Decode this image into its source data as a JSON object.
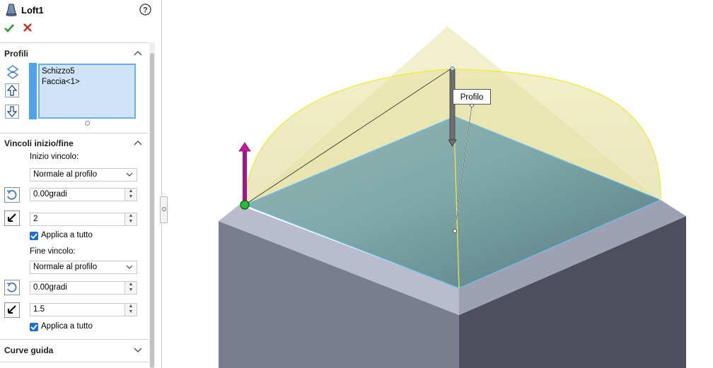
{
  "panel": {
    "title": "Loft1",
    "help_icon": "question-circle-icon",
    "ok_icon": "checkmark-icon",
    "cancel_icon": "x-icon",
    "profiles": {
      "title": "Profili",
      "items": [
        "Schizzo5",
        "Faccia<1>"
      ]
    },
    "constraints": {
      "title": "Vincoli inizio/fine",
      "start_label": "Inizio vincolo:",
      "start_type": "Normale al profilo",
      "start_angle": "0.00gradi",
      "start_length": "2",
      "start_apply_all": "Applica a tutto",
      "end_label": "Fine vincolo:",
      "end_type": "Normale al profilo",
      "end_angle": "0.00gradi",
      "end_length": "1.5",
      "end_apply_all": "Applica a tutto"
    },
    "guides": {
      "title": "Curve guida"
    }
  },
  "viewport": {
    "callout": "Profilo",
    "colors": {
      "background": "#ffffff",
      "box_side_left": "#7a7d90",
      "box_side_right": "#4d4f5d",
      "box_top_rim": "#b9bccd",
      "face_top": "#5f8f98",
      "loft_surface": "#e6e2a6",
      "start_vector": "#a4148c",
      "accent": "#33a5e8"
    }
  }
}
